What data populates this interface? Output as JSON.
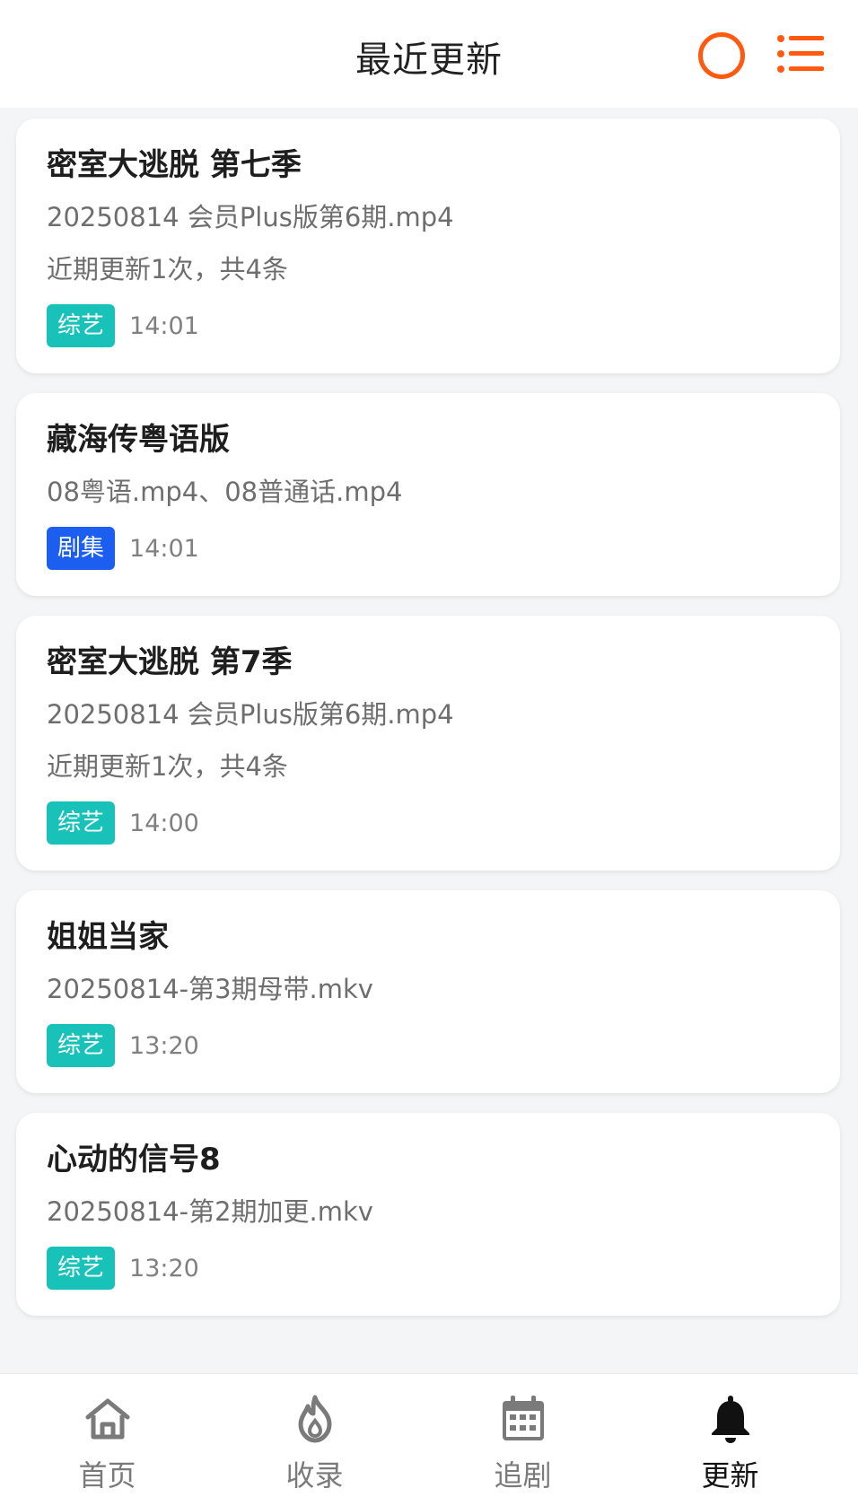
{
  "header": {
    "title": "最近更新"
  },
  "colors": {
    "accent": "#ff5a0f",
    "variety_tag": "#19c2b8",
    "drama_tag": "#1b5ef0"
  },
  "cards": [
    {
      "title": "密室大逃脱 第七季",
      "lines": [
        "20250814 会员Plus版第6期.mp4",
        "近期更新1次，共4条"
      ],
      "tag": "综艺",
      "tag_type": "variety",
      "time": "14:01"
    },
    {
      "title": "藏海传粤语版",
      "lines": [
        "08粤语.mp4、08普通话.mp4"
      ],
      "tag": "剧集",
      "tag_type": "drama",
      "time": "14:01"
    },
    {
      "title": "密室大逃脱 第7季",
      "lines": [
        "20250814 会员Plus版第6期.mp4",
        "近期更新1次，共4条"
      ],
      "tag": "综艺",
      "tag_type": "variety",
      "time": "14:00"
    },
    {
      "title": "姐姐当家",
      "lines": [
        "20250814-第3期母带.mkv"
      ],
      "tag": "综艺",
      "tag_type": "variety",
      "time": "13:20"
    },
    {
      "title": "心动的信号8",
      "lines": [
        "20250814-第2期加更.mkv"
      ],
      "tag": "综艺",
      "tag_type": "variety",
      "time": "13:20"
    }
  ],
  "nav": [
    {
      "label": "首页",
      "icon": "home-icon"
    },
    {
      "label": "收录",
      "icon": "flame-icon"
    },
    {
      "label": "追剧",
      "icon": "calendar-icon"
    },
    {
      "label": "更新",
      "icon": "bell-icon",
      "active": true
    }
  ]
}
